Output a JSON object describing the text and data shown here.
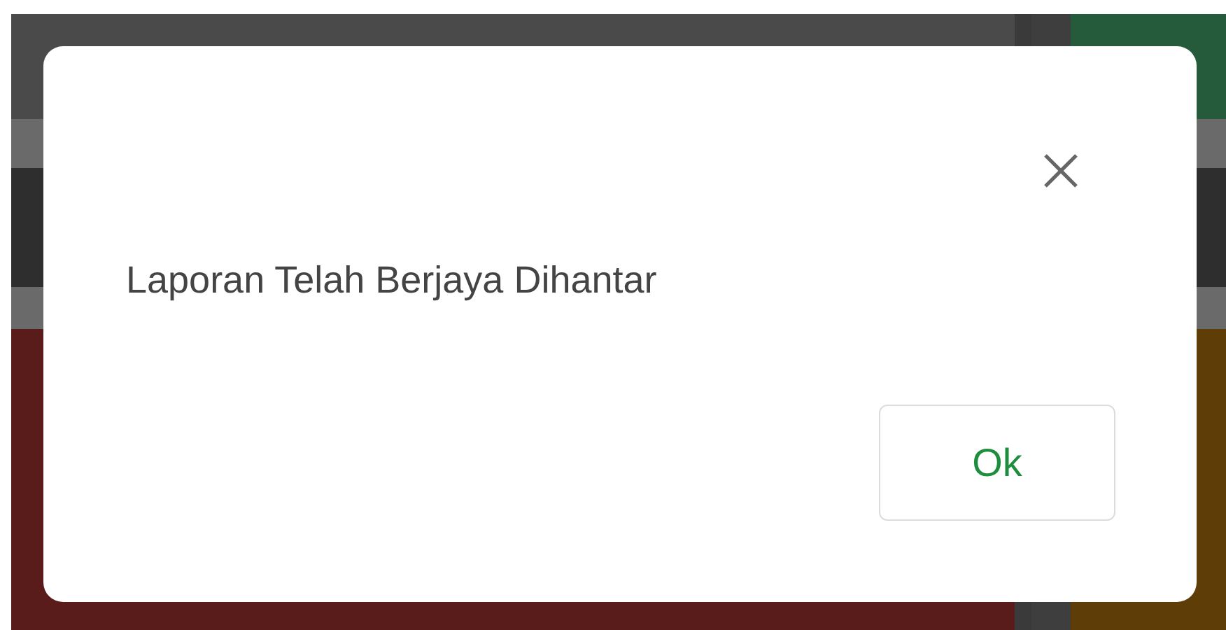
{
  "dialog": {
    "message": "Laporan Telah Berjaya Dihantar",
    "buttons": [
      {
        "label": "Ok"
      }
    ]
  }
}
